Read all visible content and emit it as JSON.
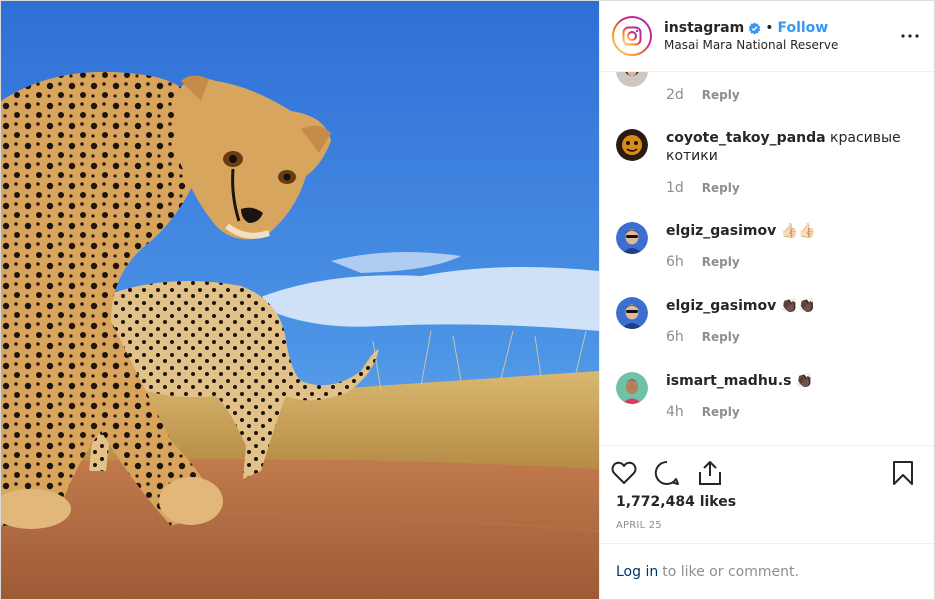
{
  "header": {
    "username": "instagram",
    "separator": "•",
    "follow_label": "Follow",
    "location": "Masai Mara National Reserve"
  },
  "comments": [
    {
      "user": "",
      "text": "",
      "age": "2d",
      "reply": "Reply"
    },
    {
      "user": "coyote_takoy_panda",
      "text": "красивые котики",
      "age": "1d",
      "reply": "Reply"
    },
    {
      "user": "elgiz_gasimov",
      "text": "👍🏻👍🏻",
      "age": "6h",
      "reply": "Reply"
    },
    {
      "user": "elgiz_gasimov",
      "text": "👏🏿👏🏿",
      "age": "6h",
      "reply": "Reply"
    },
    {
      "user": "ismart_madhu.s",
      "text": "👏🏿",
      "age": "4h",
      "reply": "Reply"
    }
  ],
  "stats": {
    "likes": "1,772,484 likes",
    "date": "APRIL 25"
  },
  "footer": {
    "login_label": "Log in",
    "login_rest": "to like or comment."
  },
  "icons": [
    "heart-icon",
    "comment-icon",
    "share-icon",
    "bookmark-icon",
    "more-options-icon",
    "verified-badge-icon",
    "instagram-logo-icon"
  ],
  "colors": {
    "accent": "#3897f0",
    "verified": "#3897f0",
    "muted": "#8e8e8e",
    "border": "#efefef"
  }
}
